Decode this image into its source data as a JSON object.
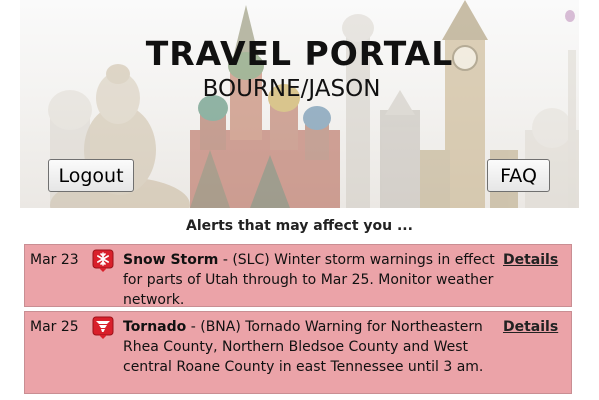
{
  "header": {
    "title": "TRAVEL PORTAL",
    "username": "BOURNE/JASON"
  },
  "buttons": {
    "logout_label": "Logout",
    "faq_label": "FAQ"
  },
  "alerts_heading": "Alerts that may affect you ...",
  "alerts": [
    {
      "date": "Mar 23",
      "icon": "snowflake-icon",
      "event": "Snow Storm",
      "description": " - (SLC) Winter storm warnings in effect for parts of Utah through to Mar 25. Monitor weather network.",
      "details_label": "Details"
    },
    {
      "date": "Mar 25",
      "icon": "tornado-icon",
      "event": "Tornado",
      "description": " - (BNA) Tornado Warning for Northeastern Rhea County, Northern Bledsoe County and West central Roane County in east Tennessee until 3 am.",
      "details_label": "Details"
    }
  ],
  "colors": {
    "alert_background": "#eba3a8",
    "alert_icon_red": "#d9202b"
  }
}
